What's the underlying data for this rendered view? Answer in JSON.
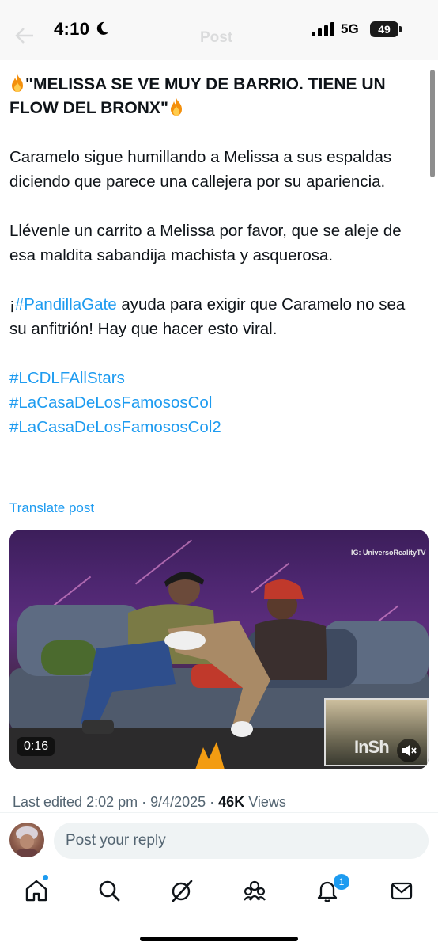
{
  "status_bar": {
    "time": "4:10",
    "network": "5G",
    "battery": "49",
    "screen_title": "Post"
  },
  "post": {
    "headline": "\"MELISSA SE VE MUY DE BARRIO. TIENE UN FLOW DEL BRONX\"",
    "paragraph_1": "Caramelo sigue humillando a Melissa a sus espaldas diciendo que parece una callejera por su apariencia.",
    "paragraph_2": "Llévenle un carrito a Melissa por favor, que se aleje de esa maldita sabandija machista y asquerosa.",
    "paragraph_3_prefix": "¡",
    "paragraph_3_hashtag": "#PandillaGate",
    "paragraph_3_suffix": " ayuda para exigir que Caramelo no sea su anfitrión! Hay que hacer esto viral.",
    "hashtags": [
      "#LCDLFAllStars",
      "#LaCasaDeLosFamososCol",
      "#LaCasaDeLosFamososCol2"
    ],
    "translate_label": "Translate post"
  },
  "video": {
    "watermark": "IG: UniversoRealityTV",
    "duration": "0:16",
    "inshot_mark": "InSh"
  },
  "meta": {
    "edited": "Last edited 2:02 pm · 9/4/2025",
    "separator": " · ",
    "views_count": "46K",
    "views_label": " Views"
  },
  "reply": {
    "placeholder": "Post your reply"
  },
  "nav": {
    "items": [
      "home-icon",
      "search-icon",
      "grok-icon",
      "communities-icon",
      "notifications-icon",
      "messages-icon"
    ],
    "notification_badge": "1"
  },
  "colors": {
    "accent": "#1d9bf0",
    "text": "#0f1419",
    "secondary": "#536471"
  }
}
